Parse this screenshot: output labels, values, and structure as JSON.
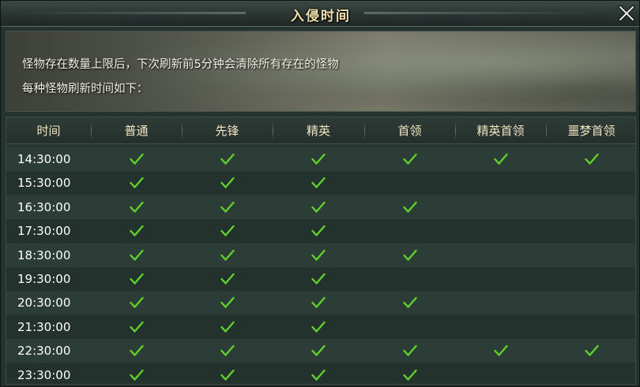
{
  "window": {
    "title": "入侵时间"
  },
  "info": {
    "line1": "怪物存在数量上限后，下次刷新前5分钟会清除所有存在的怪物",
    "line2": "每种怪物刷新时间如下："
  },
  "table": {
    "headers": [
      "时间",
      "普通",
      "先锋",
      "精英",
      "首领",
      "精英首领",
      "噩梦首领"
    ],
    "rows": [
      {
        "time": "14:30:00",
        "checks": [
          true,
          true,
          true,
          true,
          true,
          true
        ]
      },
      {
        "time": "15:30:00",
        "checks": [
          true,
          true,
          true,
          false,
          false,
          false
        ]
      },
      {
        "time": "16:30:00",
        "checks": [
          true,
          true,
          true,
          true,
          false,
          false
        ]
      },
      {
        "time": "17:30:00",
        "checks": [
          true,
          true,
          true,
          false,
          false,
          false
        ]
      },
      {
        "time": "18:30:00",
        "checks": [
          true,
          true,
          true,
          true,
          false,
          false
        ]
      },
      {
        "time": "19:30:00",
        "checks": [
          true,
          true,
          true,
          false,
          false,
          false
        ]
      },
      {
        "time": "20:30:00",
        "checks": [
          true,
          true,
          true,
          true,
          false,
          false
        ]
      },
      {
        "time": "21:30:00",
        "checks": [
          true,
          true,
          true,
          false,
          false,
          false
        ]
      },
      {
        "time": "22:30:00",
        "checks": [
          true,
          true,
          true,
          true,
          true,
          true
        ]
      },
      {
        "time": "23:30:00",
        "checks": [
          true,
          true,
          true,
          true,
          false,
          false
        ]
      }
    ]
  },
  "colors": {
    "check": "#5fd12a",
    "title": "#f2dfae",
    "header": "#f0e3c2"
  },
  "icons": {
    "close": "close-icon",
    "check": "checkmark-icon"
  }
}
